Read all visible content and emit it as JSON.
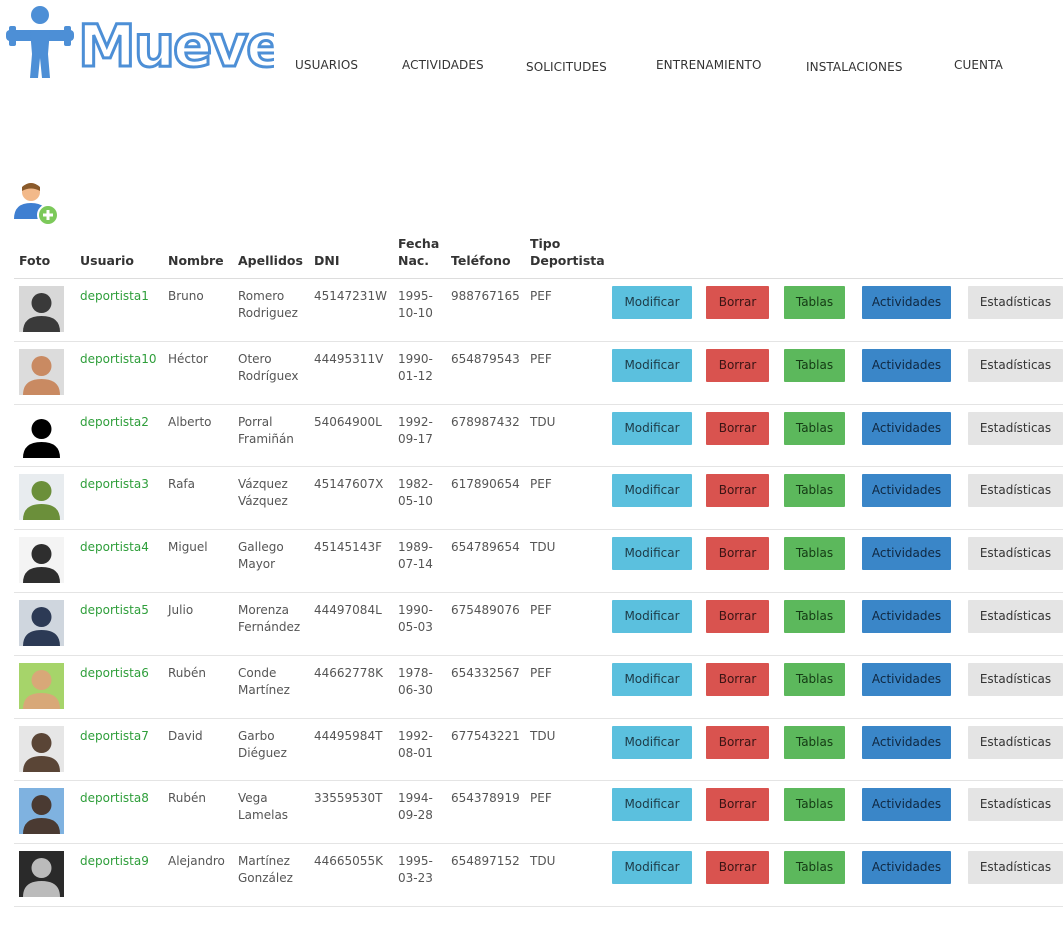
{
  "brand": {
    "logo_text": "MueveT",
    "logo_color": "#4d8fd6"
  },
  "nav": [
    {
      "label": "USUARIOS"
    },
    {
      "label": "ACTIVIDADES"
    },
    {
      "label": "SOLICITUDES"
    },
    {
      "label": "ENTRENAMIENTO"
    },
    {
      "label": "INSTALACIONES"
    },
    {
      "label": "CUENTA"
    }
  ],
  "add_user_icon": "add-user-icon",
  "table": {
    "headers": {
      "foto": "Foto",
      "usuario": "Usuario",
      "nombre": "Nombre",
      "apellidos": "Apellidos",
      "dni": "DNI",
      "fecha_line1": "Fecha",
      "fecha_line2": "Nac.",
      "telefono": "Teléfono",
      "tipo_line1": "Tipo",
      "tipo_line2": "Deportista"
    },
    "buttons": {
      "modificar": "Modificar",
      "borrar": "Borrar",
      "tablas": "Tablas",
      "actividades": "Actividades",
      "estadisticas": "Estadísticas"
    },
    "rows": [
      {
        "usuario": "deportista1",
        "nombre": "Bruno",
        "apellido1": "Romero",
        "apellido2": "Rodriguez",
        "dni": "45147231W",
        "fecha1": "1995-",
        "fecha2": "10-10",
        "telefono": "988767165",
        "tipo": "PEF"
      },
      {
        "usuario": "deportista10",
        "nombre": "Héctor",
        "apellido1": "Otero",
        "apellido2": "Rodríguex",
        "dni": "44495311V",
        "fecha1": "1990-",
        "fecha2": "01-12",
        "telefono": "654879543",
        "tipo": "PEF"
      },
      {
        "usuario": "deportista2",
        "nombre": "Alberto",
        "apellido1": "Porral",
        "apellido2": "Framiñán",
        "dni": "54064900L",
        "fecha1": "1992-",
        "fecha2": "09-17",
        "telefono": "678987432",
        "tipo": "TDU"
      },
      {
        "usuario": "deportista3",
        "nombre": "Rafa",
        "apellido1": "Vázquez",
        "apellido2": "Vázquez",
        "dni": "45147607X",
        "fecha1": "1982-",
        "fecha2": "05-10",
        "telefono": "617890654",
        "tipo": "PEF"
      },
      {
        "usuario": "deportista4",
        "nombre": "Miguel",
        "apellido1": "Gallego",
        "apellido2": "Mayor",
        "dni": "45145143F",
        "fecha1": "1989-",
        "fecha2": "07-14",
        "telefono": "654789654",
        "tipo": "TDU"
      },
      {
        "usuario": "deportista5",
        "nombre": "Julio",
        "apellido1": "Morenza",
        "apellido2": "Fernández",
        "dni": "44497084L",
        "fecha1": "1990-",
        "fecha2": "05-03",
        "telefono": "675489076",
        "tipo": "PEF"
      },
      {
        "usuario": "deportista6",
        "nombre": "Rubén",
        "apellido1": "Conde",
        "apellido2": "Martínez",
        "dni": "44662778K",
        "fecha1": "1978-",
        "fecha2": "06-30",
        "telefono": "654332567",
        "tipo": "PEF"
      },
      {
        "usuario": "deportista7",
        "nombre": "David",
        "apellido1": "Garbo",
        "apellido2": "Diéguez",
        "dni": "44495984T",
        "fecha1": "1992-",
        "fecha2": "08-01",
        "telefono": "677543221",
        "tipo": "TDU"
      },
      {
        "usuario": "deportista8",
        "nombre": "Rubén",
        "apellido1": "Vega",
        "apellido2": "Lamelas",
        "dni": "33559530T",
        "fecha1": "1994-",
        "fecha2": "09-28",
        "telefono": "654378919",
        "tipo": "PEF"
      },
      {
        "usuario": "deportista9",
        "nombre": "Alejandro",
        "apellido1": "Martínez",
        "apellido2": "González",
        "dni": "44665055K",
        "fecha1": "1995-",
        "fecha2": "03-23",
        "telefono": "654897152",
        "tipo": "TDU"
      }
    ]
  }
}
